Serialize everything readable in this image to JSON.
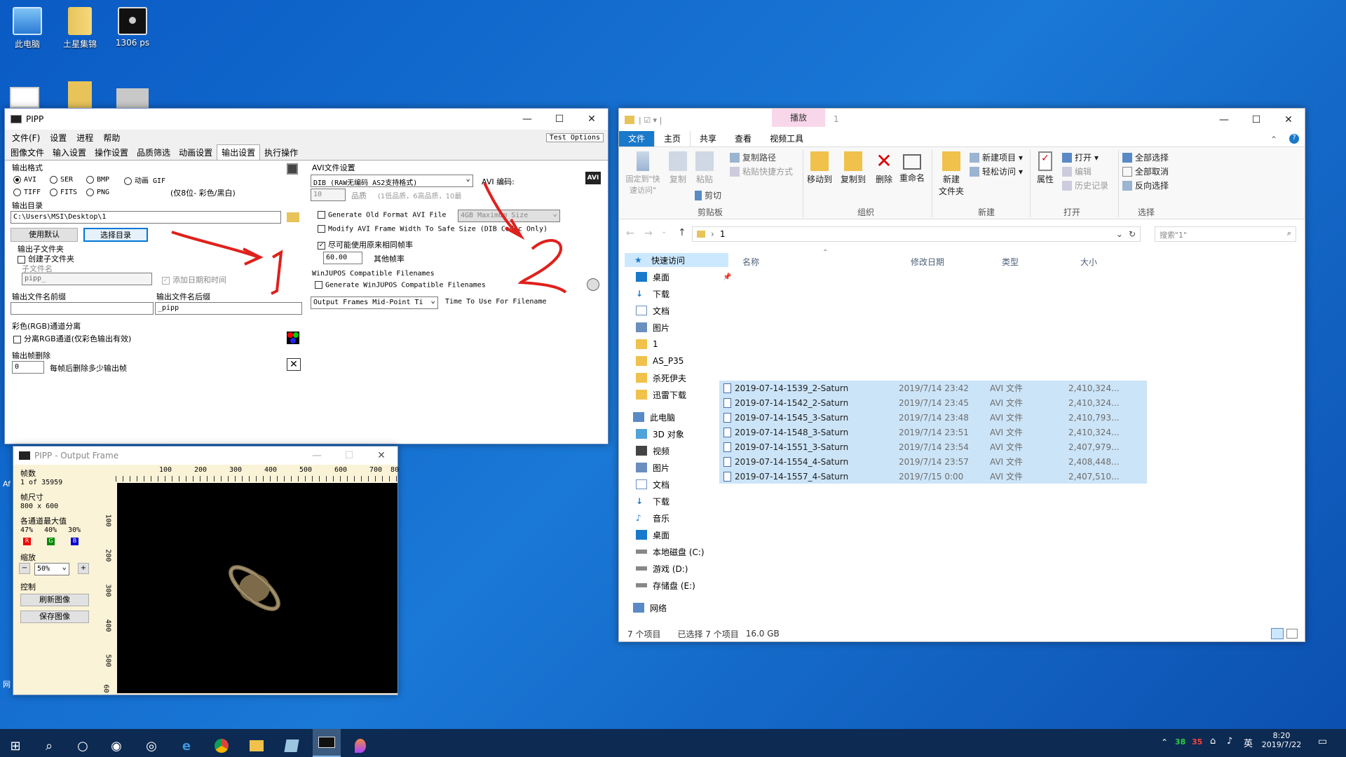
{
  "desktop": {
    "icons": [
      {
        "label": "此电脑",
        "icon": "computer-icon"
      },
      {
        "label": "土星集锦",
        "icon": "folder-icon"
      },
      {
        "label": "1306 ps",
        "icon": "image-file-icon"
      }
    ],
    "partial_labels": [
      "Af",
      "网"
    ]
  },
  "pipp": {
    "title": "PIPP",
    "menu": [
      "文件(F)",
      "设置",
      "进程",
      "帮助"
    ],
    "test_options": "Test Options",
    "tabs": [
      "图像文件",
      "输入设置",
      "操作设置",
      "品质筛选",
      "动画设置",
      "输出设置",
      "执行操作"
    ],
    "active_tab": "输出设置",
    "output_format": {
      "title": "输出格式",
      "options": [
        "AVI",
        "SER",
        "BMP",
        "动画 GIF",
        "TIFF",
        "FITS",
        "PNG"
      ],
      "selected": "AVI",
      "note": "(仅8位- 彩色/黑白)"
    },
    "output_dir": {
      "title": "输出目录",
      "path": "C:\\Users\\MSI\\Desktop\\1",
      "use_default": "使用默认",
      "select_dir": "选择目录"
    },
    "subfolder": {
      "title": "输出子文件夹",
      "create": "创建子文件夹",
      "name_label": "子文件名",
      "name_value": "pipp_",
      "add_date": "添加日期和时间"
    },
    "prefix": {
      "title": "输出文件名前缀",
      "value": ""
    },
    "suffix": {
      "title": "输出文件名后缀",
      "value": "_pipp"
    },
    "rgb": {
      "title": "彩色(RGB)通道分离",
      "option": "分离RGB通道(仅彩色输出有效)"
    },
    "frame_drop": {
      "title": "输出帧删除",
      "value": "0",
      "label": "每帧后删除多少输出帧"
    },
    "avi": {
      "title": "AVI文件设置",
      "codec_select": "DIB (RAW无编码 AS2支持格式)",
      "codec_label": "AVI 编码:",
      "quality_value": "10",
      "quality_label": "品质",
      "quality_hint": "(1低品质，6高品质，10最",
      "old_format": "Generate Old Format AVI File",
      "max_size": "4GB Maximum Size",
      "modify_width": "Modify AVI Frame Width To Safe Size (DIB Codec Only)",
      "same_rate": "尽可能使用原来相同帧率",
      "fps_value": "60.00",
      "fps_label": "其他帧率",
      "avi_badge": "AVI"
    },
    "winjupos": {
      "title": "WinJUPOS Compatible Filenames",
      "generate": "Generate WinJUPOS Compatible Filenames",
      "select": "Output Frames Mid-Point Ti",
      "time_label": "Time To Use For Filename"
    },
    "annotations": [
      "1",
      "2"
    ]
  },
  "output_frame": {
    "title": "PIPP - Output Frame",
    "frames_label": "帧数",
    "frames_value": "1 of 35959",
    "size_label": "帧尺寸",
    "size_value": "800 x 600",
    "max_label": "各通道最大值",
    "max_values": [
      "47%",
      "40%",
      "30%"
    ],
    "channels": [
      "R",
      "G",
      "B"
    ],
    "zoom_label": "缩放",
    "zoom_value": "50%",
    "zoom_minus": "−",
    "zoom_plus": "+",
    "control_label": "控制",
    "refresh": "刷新图像",
    "save": "保存图像",
    "ruler_x": [
      "100",
      "200",
      "300",
      "400",
      "500",
      "600",
      "700",
      "80"
    ],
    "ruler_y": [
      "100",
      "200",
      "300",
      "400",
      "500",
      "60"
    ]
  },
  "explorer": {
    "title": "1",
    "context_tab": "播放",
    "tabs": [
      "文件",
      "主页",
      "共享",
      "查看",
      "视频工具"
    ],
    "ribbon": {
      "pin": "固定到\"快\n速访问\"",
      "copy": "复制",
      "paste": "粘贴",
      "copy_path": "复制路径",
      "paste_shortcut": "粘贴快捷方式",
      "cut": "剪切",
      "clipboard": "剪贴板",
      "move_to": "移动到",
      "copy_to": "复制到",
      "delete": "删除",
      "rename": "重命名",
      "organize": "组织",
      "new_folder": "新建\n文件夹",
      "new_item": "新建项目",
      "easy_access": "轻松访问",
      "new_group": "新建",
      "properties": "属性",
      "open": "打开",
      "edit": "编辑",
      "history": "历史记录",
      "open_group": "打开",
      "select_all": "全部选择",
      "select_none": "全部取消",
      "invert": "反向选择",
      "select_group": "选择"
    },
    "address": "1",
    "search_placeholder": "搜索\"1\"",
    "nav": [
      {
        "label": "快速访问",
        "icon": "star-icon"
      },
      {
        "label": "桌面",
        "icon": "desktop-icon"
      },
      {
        "label": "下载",
        "icon": "download-icon"
      },
      {
        "label": "文档",
        "icon": "document-icon"
      },
      {
        "label": "图片",
        "icon": "picture-icon"
      },
      {
        "label": "1",
        "icon": "folder-icon"
      },
      {
        "label": "AS_P35",
        "icon": "folder-icon"
      },
      {
        "label": "杀死伊夫",
        "icon": "folder-icon"
      },
      {
        "label": "迅雷下载",
        "icon": "folder-icon"
      },
      {
        "label": "此电脑",
        "icon": "computer-icon"
      },
      {
        "label": "3D 对象",
        "icon": "cube-icon"
      },
      {
        "label": "视频",
        "icon": "video-icon"
      },
      {
        "label": "图片",
        "icon": "picture-icon"
      },
      {
        "label": "文档",
        "icon": "document-icon"
      },
      {
        "label": "下载",
        "icon": "download-icon"
      },
      {
        "label": "音乐",
        "icon": "music-icon"
      },
      {
        "label": "桌面",
        "icon": "desktop-icon"
      },
      {
        "label": "本地磁盘 (C:)",
        "icon": "drive-icon"
      },
      {
        "label": "游戏 (D:)",
        "icon": "drive-icon"
      },
      {
        "label": "存储盘 (E:)",
        "icon": "drive-icon"
      },
      {
        "label": "网络",
        "icon": "network-icon"
      }
    ],
    "columns": [
      "名称",
      "修改日期",
      "类型",
      "大小"
    ],
    "files": [
      [
        "2019-07-14-1539_2-Saturn",
        "2019/7/14 23:42",
        "AVI 文件",
        "2,410,324..."
      ],
      [
        "2019-07-14-1542_2-Saturn",
        "2019/7/14 23:45",
        "AVI 文件",
        "2,410,324..."
      ],
      [
        "2019-07-14-1545_3-Saturn",
        "2019/7/14 23:48",
        "AVI 文件",
        "2,410,793..."
      ],
      [
        "2019-07-14-1548_3-Saturn",
        "2019/7/14 23:51",
        "AVI 文件",
        "2,410,324..."
      ],
      [
        "2019-07-14-1551_3-Saturn",
        "2019/7/14 23:54",
        "AVI 文件",
        "2,407,979..."
      ],
      [
        "2019-07-14-1554_4-Saturn",
        "2019/7/14 23:57",
        "AVI 文件",
        "2,408,448..."
      ],
      [
        "2019-07-14-1557_4-Saturn",
        "2019/7/15 0:00",
        "AVI 文件",
        "2,407,510..."
      ]
    ],
    "status": {
      "count": "7 个项目",
      "selected": "已选择 7 个项目",
      "size": "16.0 GB"
    }
  },
  "taskbar": {
    "tray_green": "38",
    "tray_red": "35",
    "ime": "英",
    "time": "8:20",
    "date": "2019/7/22"
  }
}
